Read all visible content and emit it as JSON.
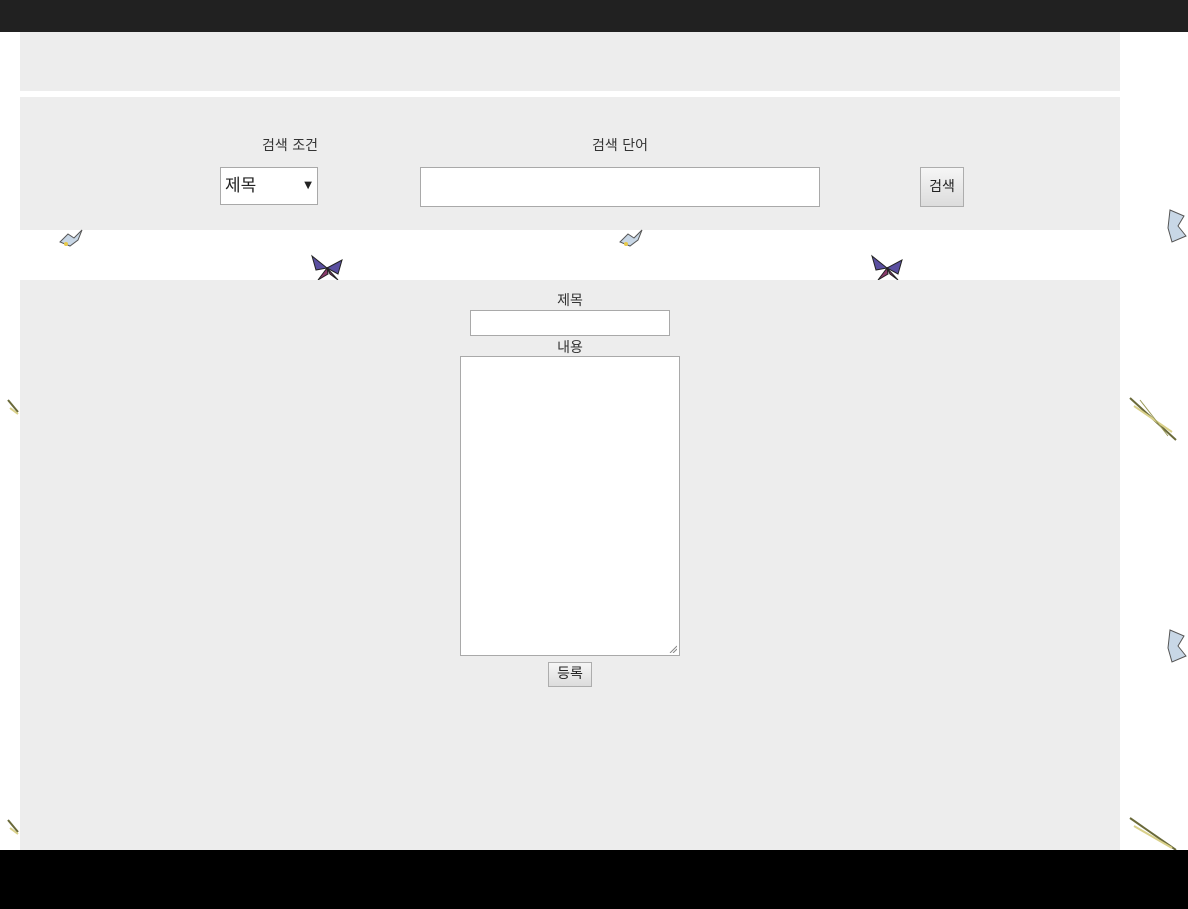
{
  "search": {
    "condition_label": "검색 조건",
    "condition_value": "제목",
    "word_label": "검색 단어",
    "word_value": "",
    "button_label": "검색"
  },
  "form": {
    "title_label": "제목",
    "title_value": "",
    "content_label": "내용",
    "content_value": "",
    "submit_label": "등록"
  },
  "decorations": {
    "butterfly_color": "#5a4fa0",
    "accent": "#ededed"
  }
}
